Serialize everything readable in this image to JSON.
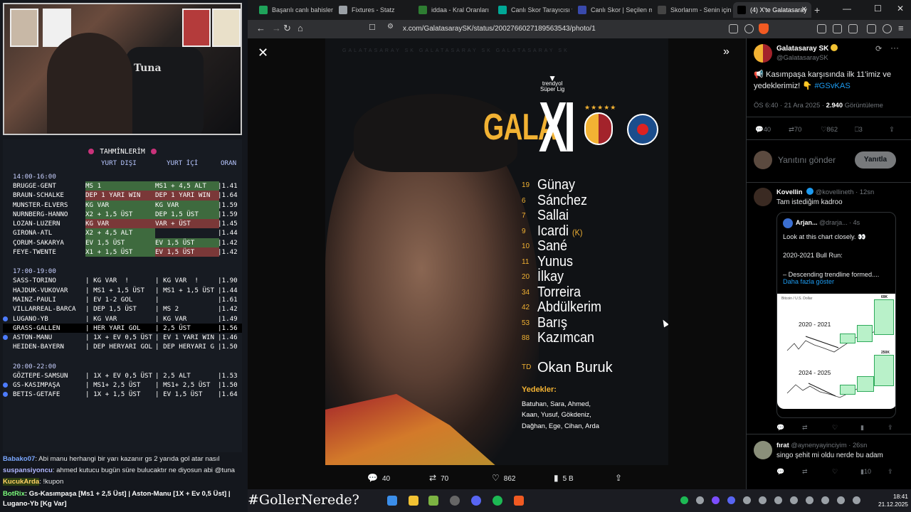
{
  "stream": {
    "webcam_chair_text": "Tuna",
    "predictions": {
      "title": "TAHMİNLERİM",
      "headers": {
        "away": "YURT DIŞI",
        "home": "YURT İÇİ",
        "odds": "ORAN"
      },
      "slots": [
        {
          "time": "14:00-16:00",
          "rows": [
            {
              "match": "BRUGGE-GENT",
              "dis": "MS 1",
              "ic": "MS1 + 4,5 ALT",
              "oran": "|1.41",
              "style": "green",
              "bullet": false
            },
            {
              "match": "BRAUN-SCHALKE",
              "dis": "DEP 1 YARI WIN",
              "ic": "DEP 1 YARI WIN",
              "oran": "|1.64",
              "style": "red",
              "bullet": false
            },
            {
              "match": "MUNSTER-ELVERS",
              "dis": "KG VAR",
              "ic": "KG VAR",
              "oran": "|1.59",
              "style": "green",
              "bullet": false
            },
            {
              "match": "NURNBERG-HANNO",
              "dis": "X2 + 1,5 ÜST",
              "ic": "DEP 1,5 ÜST",
              "oran": "|1.59",
              "style": "green",
              "bullet": false
            },
            {
              "match": "LOZAN-LUZERN",
              "dis": "KG VAR",
              "ic": "VAR + ÜST",
              "oran": "|1.45",
              "style": "red",
              "bullet": false
            },
            {
              "match": "GIRONA-ATL",
              "dis": "X2 + 4,5 ALT",
              "ic": "",
              "oran": "|1.44",
              "style": "green",
              "bullet": false
            },
            {
              "match": "ÇORUM-SAKARYA",
              "dis": "EV 1,5 ÜST",
              "ic": "EV 1,5 ÜST",
              "oran": "|1.42",
              "style": "green",
              "bullet": false
            },
            {
              "match": "FEYE-TWENTE",
              "dis": "X1 + 1,5 ÜST",
              "ic": "EV 1,5 ÜST",
              "oran": "|1.42",
              "style": "green-red",
              "bullet": false
            }
          ]
        },
        {
          "time": "17:00-19:00",
          "rows": [
            {
              "match": "SASS-TORINO",
              "dis": "| KG VAR  !",
              "ic": "| KG VAR  !",
              "oran": "|1.90",
              "style": "plain",
              "bullet": false
            },
            {
              "match": "HAJDUK-VUKOVAR",
              "dis": "| MS1 + 1,5 ÜST",
              "ic": "| MS1 + 1,5 ÜST",
              "oran": "|1.44",
              "style": "plain",
              "bullet": false
            },
            {
              "match": "MAINZ-PAULI",
              "dis": "| EV 1-2 GOL",
              "ic": "|",
              "oran": "|1.61",
              "style": "plain",
              "bullet": false
            },
            {
              "match": "VILLARREAL-BARCA",
              "dis": "| DEP 1,5 ÜST",
              "ic": "| MS 2",
              "oran": "|1.42",
              "style": "plain",
              "bullet": false
            },
            {
              "match": "LUGANO-YB",
              "dis": "| KG VAR",
              "ic": "| KG VAR",
              "oran": "|1.49",
              "style": "plain",
              "bullet": true
            },
            {
              "match": "GRASS-GALLEN",
              "dis": "| HER YARI GOL",
              "ic": "| 2,5 ÜST",
              "oran": "|1.56",
              "style": "sel",
              "bullet": false
            },
            {
              "match": "ASTON-MANU",
              "dis": "| 1X + EV 0,5 ÜST",
              "ic": "| EV 1 YARI WIN",
              "oran": "|1.46",
              "style": "plain",
              "bullet": true
            },
            {
              "match": "HEIDEN-BAYERN",
              "dis": "| DEP HERYARI GOL",
              "ic": "| DEP HERYARI G",
              "oran": "|1.50",
              "style": "plain",
              "bullet": false
            }
          ]
        },
        {
          "time": "20:00-22:00",
          "rows": [
            {
              "match": "GÖZTEPE-SAMSUN",
              "dis": "| 1X + EV 0,5 ÜST",
              "ic": "| 2,5 ALT",
              "oran": "|1.53",
              "style": "plain",
              "bullet": false
            },
            {
              "match": "GS-KASIMPAŞA",
              "dis": "| MS1+ 2,5 ÜST",
              "ic": "| MS1+ 2,5 ÜST",
              "oran": "|1.50",
              "style": "plain",
              "bullet": true
            },
            {
              "match": "BETIS-GETAFE",
              "dis": "| 1X + 1,5 ÜST",
              "ic": "| EV 1,5 ÜST",
              "oran": "|1.64",
              "style": "plain",
              "bullet": true
            }
          ]
        }
      ]
    },
    "chat": [
      {
        "user": "Babako07",
        "msg": ": Abi manu herhangi bir yarı kazanır gs 2 yarıda gol atar nasıl",
        "cls": "u1"
      },
      {
        "user": "suspansiyoncu",
        "msg": ": ahmed kutucu bugün süre bulucaktır ne diyosun abi @tuna",
        "cls": "u2"
      },
      {
        "user": "KucukArda",
        "msg": ": !kupon",
        "cls": "u3"
      },
      {
        "user": "BotRix",
        "msg": ": Gs-Kasımpaşa [Ms1 + 2,5 Üst] | Aston-Manu [1X + Ev 0,5 Üst] | Lugano-Yb [Kg Var]",
        "cls": "u4"
      }
    ]
  },
  "browser": {
    "tabs": [
      {
        "label": "Başarılı canlı bahisler k",
        "color": "#1fa35a"
      },
      {
        "label": "Fixtures - Statz",
        "color": "#9aa0a6"
      },
      {
        "label": "iddaa - Kral Oranları",
        "color": "#2e7d32"
      },
      {
        "label": "Canlı Skor Tarayıcısı ve",
        "color": "#00a896"
      },
      {
        "label": "Canlı Skor | Seçilen ma",
        "color": "#3949ab"
      },
      {
        "label": "Skorlarım - Senin için",
        "color": "#444"
      },
      {
        "label": "(4) X'te Galatasaray",
        "color": "#000"
      }
    ],
    "url": "x.com/GalatasaraySK/status/2002766027189563543/photo/1"
  },
  "graphic": {
    "watermark": "GALATASARAY SK        GALATASARAY SK        GALATASARAY SK",
    "league_line1": "trendyol",
    "league_line2": "Süper Lig",
    "stars": "★★★★★",
    "gala": "GALA",
    "xi": "XI",
    "lineup": [
      {
        "no": "19",
        "name": "Günay",
        "captain": ""
      },
      {
        "no": "6",
        "name": "Sánchez",
        "captain": ""
      },
      {
        "no": "7",
        "name": "Sallai",
        "captain": ""
      },
      {
        "no": "9",
        "name": "Icardi",
        "captain": "(K)"
      },
      {
        "no": "10",
        "name": "Sané",
        "captain": ""
      },
      {
        "no": "11",
        "name": "Yunus",
        "captain": ""
      },
      {
        "no": "20",
        "name": "İlkay",
        "captain": ""
      },
      {
        "no": "34",
        "name": "Torreira",
        "captain": ""
      },
      {
        "no": "42",
        "name": "Abdülkerim",
        "captain": ""
      },
      {
        "no": "53",
        "name": "Barış",
        "captain": ""
      },
      {
        "no": "88",
        "name": "Kazımcan",
        "captain": ""
      }
    ],
    "coach": {
      "no": "TD",
      "name": "Okan Buruk"
    },
    "subs_title": "Yedekler:",
    "subs": "Batuhan, Sara, Ahmed, Kaan, Yusuf, Gökdeniz, Dağhan, Ege, Cihan, Arda"
  },
  "photo_actions": {
    "replies": "40",
    "reposts": "70",
    "likes": "862",
    "views": "5 B"
  },
  "tweet": {
    "author": "Galatasaray SK",
    "handle": "@GalatasaraySK",
    "text_prefix": "📢 Kasımpaşa karşısında ilk 11'imiz ve yedeklerimiz! 👇 ",
    "hashtag": "#GSvKAS",
    "time": "ÖS 6:40 · 21 Ara 2025 · ",
    "views_count": "2.940",
    "views_label": " Görüntüleme",
    "replies": "40",
    "reposts": "70",
    "likes": "862",
    "bookmarks": "3",
    "reply_placeholder": "Yanıtını gönder",
    "reply_button": "Yanıtla"
  },
  "replies": [
    {
      "name": "Kovellin",
      "handle": "@kovellineth · 12sn",
      "text": "Tam istediğim kadroo",
      "quote": {
        "name": "Arjan...",
        "handle": "@drarja... · 4s",
        "text": "Look at this chart closely. 👀\n\n2020-2021 Bull Run:\n\n– Descending trendline formed....",
        "more": "Daha fazla göster",
        "chart_title": "Bitcoin / U.S. Dollar",
        "label1": "2020 - 2021",
        "label2": "2024 - 2025",
        "tag1": "69K",
        "tag2": "250K"
      },
      "actions": {
        "replies": "",
        "reposts": "",
        "likes": "",
        "views": ""
      }
    },
    {
      "name": "fırat",
      "handle": "@aynenyayinciyim · 26sn",
      "text": "singo şehit mi oldu nerde bu adam",
      "actions": {
        "replies": "",
        "reposts": "",
        "likes": "",
        "views": "10"
      }
    }
  ],
  "taskbar": {
    "hashtag": "#GollerNerede?",
    "time": "18:41",
    "date": "21.12.2025"
  }
}
